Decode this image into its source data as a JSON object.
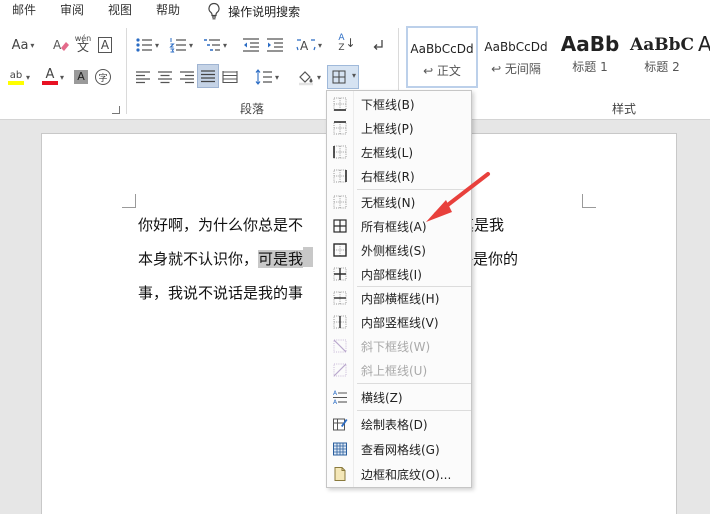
{
  "menubar": {
    "items": [
      "邮件",
      "审阅",
      "视图",
      "帮助"
    ],
    "tell_me": "操作说明搜索"
  },
  "ribbon": {
    "paragraph_group_label": "段落",
    "styles_group_label": "样式",
    "font_size_label": "Aa",
    "wen_label_top": "wén",
    "wen_label_bottom": "文",
    "a_box_label": "A",
    "highlight_label": "ab",
    "font_color_label": "A",
    "shade_label": "A",
    "char_border_label": "字",
    "sort_top": "A",
    "sort_bottom": "Z",
    "asian_layout_label": "A",
    "highlight_color": "#ffff00",
    "font_color": "#e81123"
  },
  "styles": [
    {
      "sample": "AaBbCcDd",
      "name": "↩ 正文"
    },
    {
      "sample": "AaBbCcDd",
      "name": "↩ 无间隔"
    },
    {
      "sample": "AaBb",
      "name": "标题 1"
    },
    {
      "sample": "AaBbC",
      "name": "标题 2"
    },
    {
      "sample": "A",
      "name": ""
    }
  ],
  "document": {
    "line1": "你好啊，为什么你总是不",
    "line1_end": "说话，尤其是我",
    "line2_start": "本身就不认识你，",
    "line2_hl": "可是我",
    "line2_end": "你打招呼是你的",
    "line3": "事，我说不说话是我的事",
    "para_mark": "↵"
  },
  "dropdown": {
    "items": [
      {
        "label": "下框线(B)",
        "icon": "border-bottom-icon",
        "disabled": false
      },
      {
        "label": "上框线(P)",
        "icon": "border-top-icon",
        "disabled": false
      },
      {
        "label": "左框线(L)",
        "icon": "border-left-icon",
        "disabled": false
      },
      {
        "label": "右框线(R)",
        "icon": "border-right-icon",
        "disabled": false
      },
      {
        "label": "无框线(N)",
        "icon": "border-none-icon",
        "disabled": false
      },
      {
        "label": "所有框线(A)",
        "icon": "border-all-icon",
        "disabled": false
      },
      {
        "label": "外侧框线(S)",
        "icon": "border-outside-icon",
        "disabled": false
      },
      {
        "label": "内部框线(I)",
        "icon": "border-inside-icon",
        "disabled": false
      },
      {
        "label": "内部横框线(H)",
        "icon": "border-inside-horizontal-icon",
        "disabled": false
      },
      {
        "label": "内部竖框线(V)",
        "icon": "border-inside-vertical-icon",
        "disabled": false
      },
      {
        "label": "斜下框线(W)",
        "icon": "diagonal-down-border-icon",
        "disabled": true
      },
      {
        "label": "斜上框线(U)",
        "icon": "diagonal-up-border-icon",
        "disabled": true
      },
      {
        "label": "横线(Z)",
        "icon": "horizontal-line-icon",
        "disabled": false
      },
      {
        "label": "绘制表格(D)",
        "icon": "draw-table-icon",
        "disabled": false
      },
      {
        "label": "查看网格线(G)",
        "icon": "view-gridlines-icon",
        "disabled": false
      },
      {
        "label": "边框和底纹(O)...",
        "icon": "borders-and-shading-icon",
        "disabled": false
      }
    ]
  },
  "colors": {
    "accent_arrow": "#e8403c",
    "selection_blue": "#d6e3f2"
  }
}
